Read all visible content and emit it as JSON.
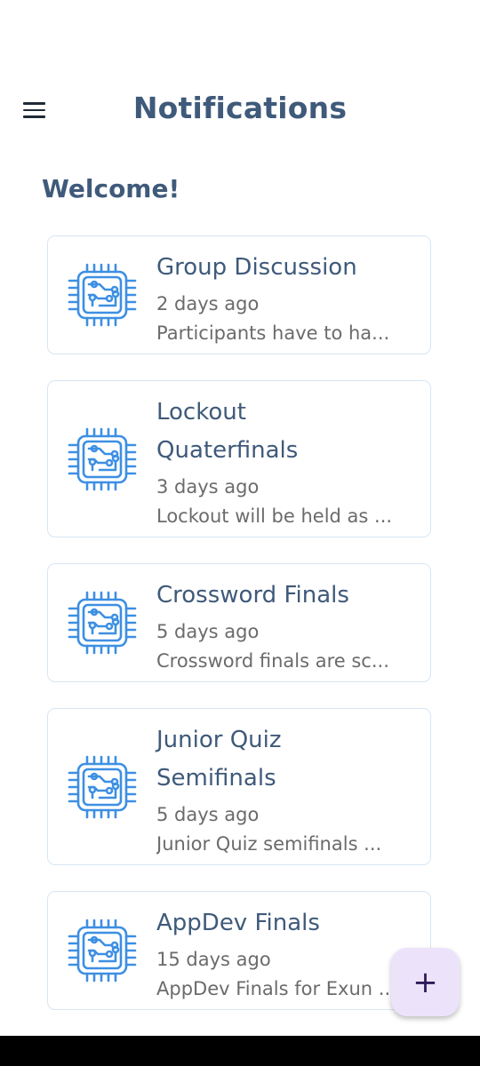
{
  "header": {
    "title": "Notifications",
    "menu_icon": "hamburger-menu-icon"
  },
  "welcome": "Welcome!",
  "notifications": [
    {
      "title": "Group Discussion",
      "date": "2 days ago",
      "preview": "Participants have to ha...",
      "icon": "circuit-chip-icon"
    },
    {
      "title": "Lockout",
      "title2": "Quaterfinals",
      "date": "3 days ago",
      "preview": "Lockout will be held as ...",
      "icon": "circuit-chip-icon"
    },
    {
      "title": "Crossword Finals",
      "date": "5 days ago",
      "preview": "Crossword finals are sc...",
      "icon": "circuit-chip-icon"
    },
    {
      "title": "Junior Quiz",
      "title2": "Semifinals",
      "date": "5 days ago",
      "preview": "Junior Quiz semifinals ...",
      "icon": "circuit-chip-icon"
    },
    {
      "title": "AppDev Finals",
      "date": "15 days ago",
      "preview": "AppDev Finals for Exun ...",
      "icon": "circuit-chip-icon"
    }
  ],
  "fab": {
    "label": "+",
    "icon": "plus-icon"
  },
  "colors": {
    "accent": "#3f5a7a",
    "icon_blue": "#3d8fe3",
    "fab_bg": "#ece3fb"
  }
}
